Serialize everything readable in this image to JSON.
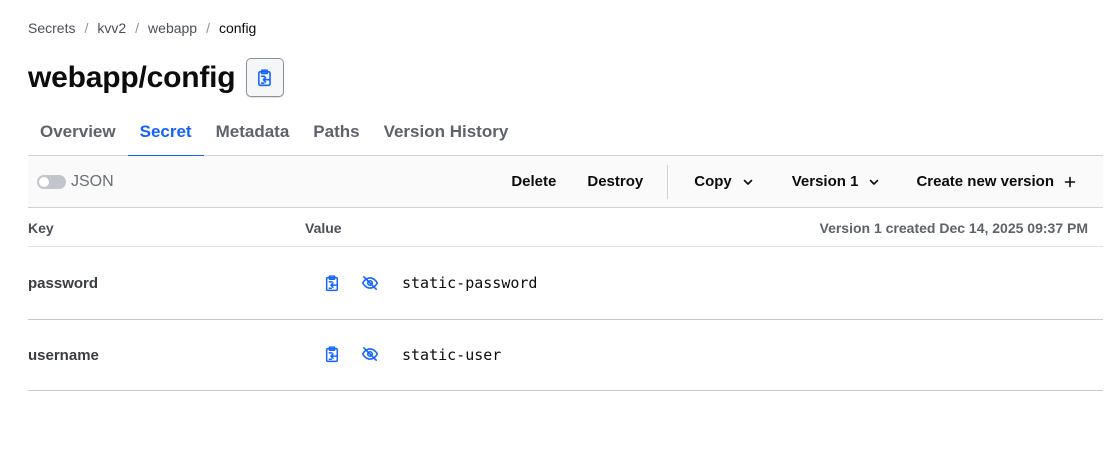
{
  "breadcrumb": {
    "items": [
      "Secrets",
      "kvv2",
      "webapp"
    ],
    "current": "config",
    "separator": "/"
  },
  "page": {
    "title": "webapp/config",
    "copy_icon": "clipboard-copy-icon"
  },
  "tabs": [
    {
      "label": "Overview",
      "active": false
    },
    {
      "label": "Secret",
      "active": true
    },
    {
      "label": "Metadata",
      "active": false
    },
    {
      "label": "Paths",
      "active": false
    },
    {
      "label": "Version History",
      "active": false
    }
  ],
  "toolbar": {
    "json_toggle_label": "JSON",
    "json_toggle_on": false,
    "delete_label": "Delete",
    "destroy_label": "Destroy",
    "copy_label": "Copy",
    "version_label": "Version 1",
    "create_label": "Create new version"
  },
  "table": {
    "key_header": "Key",
    "value_header": "Value",
    "version_info": "Version 1 created Dec 14, 2025 09:37 PM",
    "rows": [
      {
        "key": "password",
        "value": "static-password"
      },
      {
        "key": "username",
        "value": "static-user"
      }
    ]
  },
  "colors": {
    "accent": "#1563ff",
    "text": "#0c0c0e",
    "muted": "#5d626b"
  }
}
